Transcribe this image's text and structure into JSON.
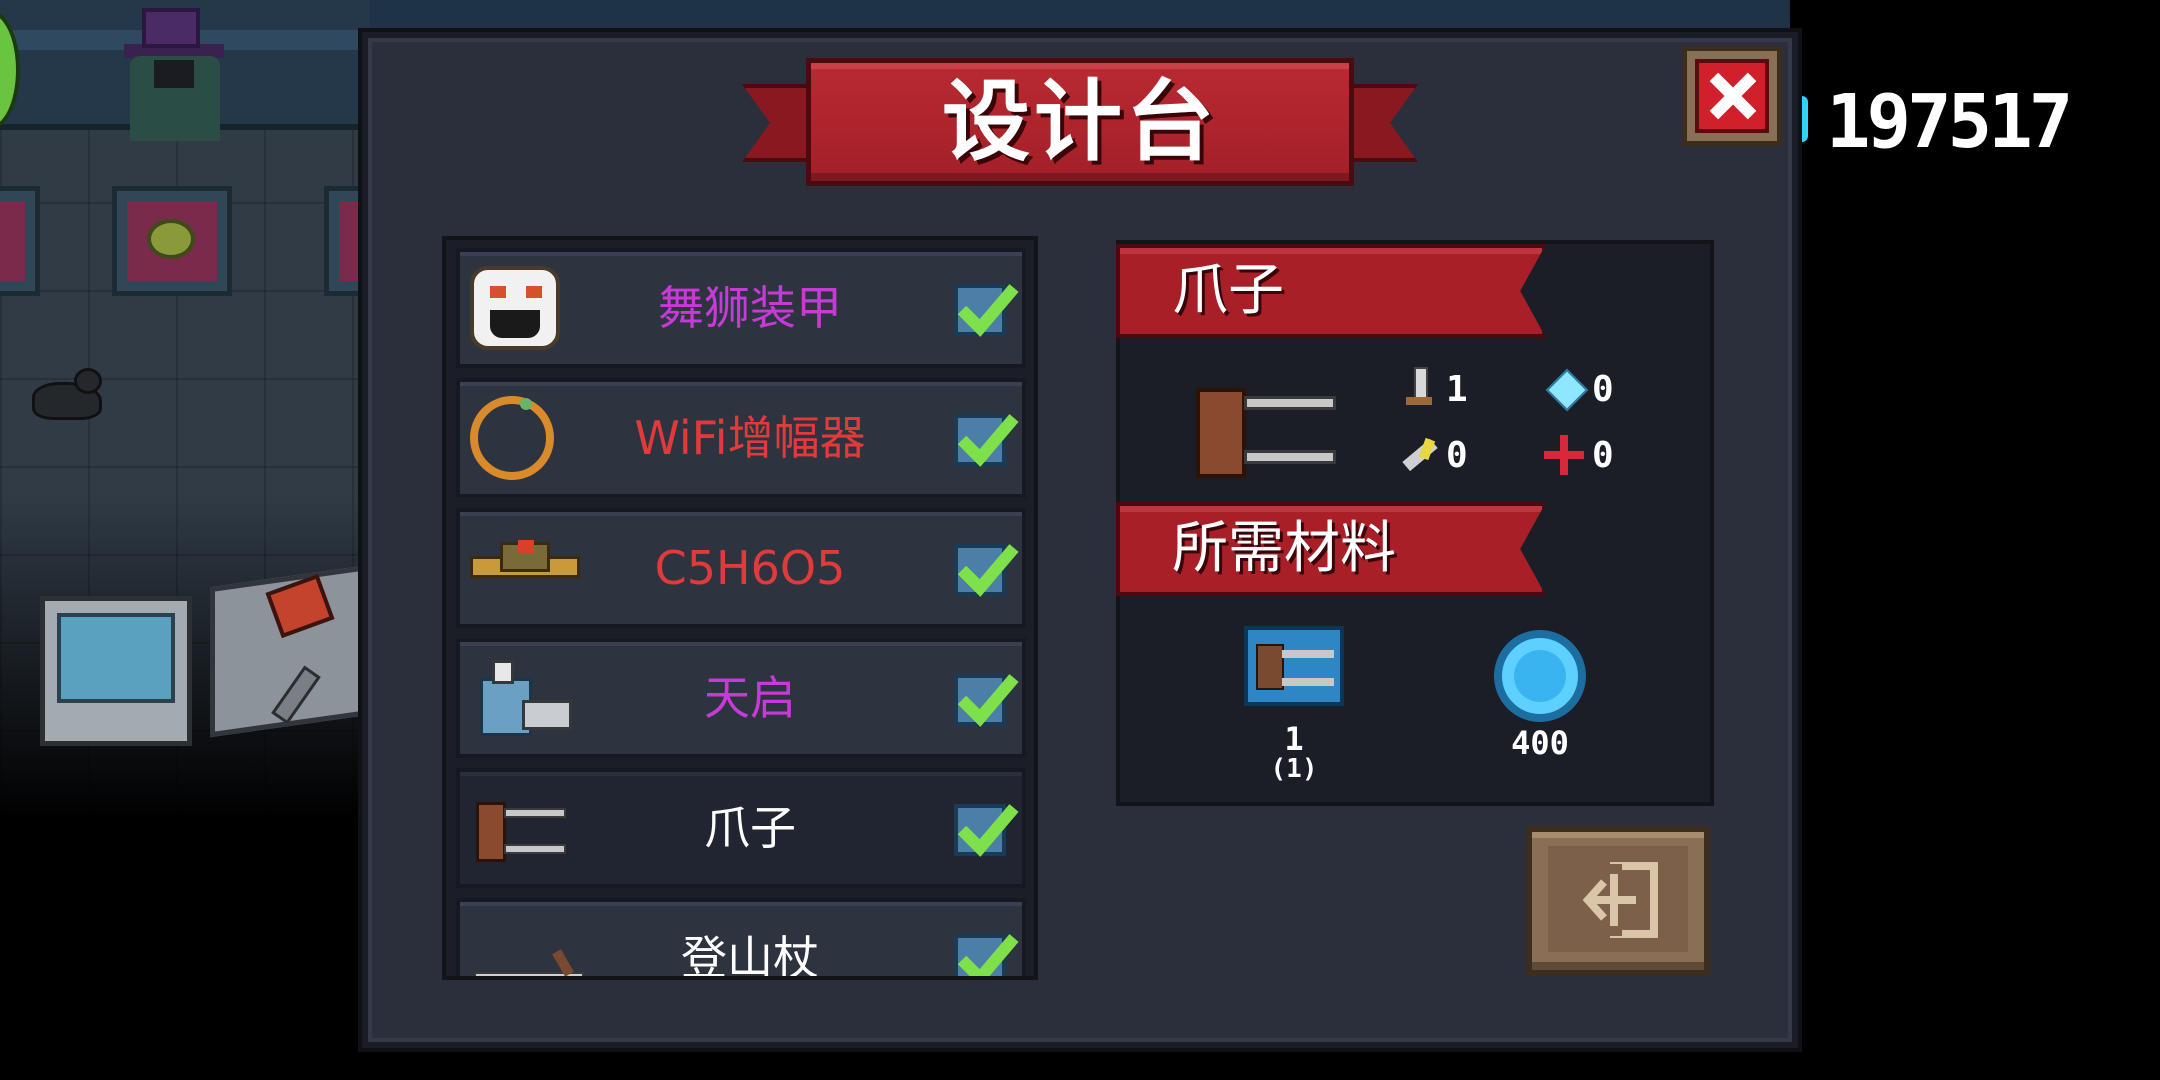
{
  "title": "设计台",
  "score": "197517",
  "colors": {
    "panel": "#2b2f3b",
    "banner": "#a81f28",
    "check": "#4b7fa8",
    "check_mark": "#7ee04a",
    "purple_label": "#c83ad8",
    "red_label": "#e03a3a",
    "white_label": "#ffffff"
  },
  "items": [
    {
      "label": "舞狮装甲",
      "color": "#c83ad8",
      "icon": "lion-armor-icon",
      "checked": true
    },
    {
      "label": "WiFi增幅器",
      "color": "#e03a3a",
      "icon": "wifi-ring-icon",
      "checked": true
    },
    {
      "label": "C5H6O5",
      "color": "#e03a3a",
      "icon": "gun-icon",
      "checked": true
    },
    {
      "label": "天启",
      "color": "#c83ad8",
      "icon": "mech-icon",
      "checked": true
    },
    {
      "label": "爪子",
      "color": "#ffffff",
      "icon": "claw-icon",
      "checked": true
    },
    {
      "label": "登山杖",
      "color": "#ffffff",
      "icon": "staff-icon",
      "checked": true
    }
  ],
  "detail": {
    "name": "爪子",
    "stats": [
      {
        "icon": "sword-icon",
        "value": "1"
      },
      {
        "icon": "diamond-icon",
        "value": "0"
      },
      {
        "icon": "bolt-icon",
        "value": "0"
      },
      {
        "icon": "crosshair-icon",
        "value": "0"
      }
    ],
    "materials_header": "所需材料",
    "materials": [
      {
        "icon": "claw-blueprint-icon",
        "count": "1",
        "owned": "(1)"
      },
      {
        "icon": "gem-icon",
        "count": "400"
      }
    ]
  }
}
